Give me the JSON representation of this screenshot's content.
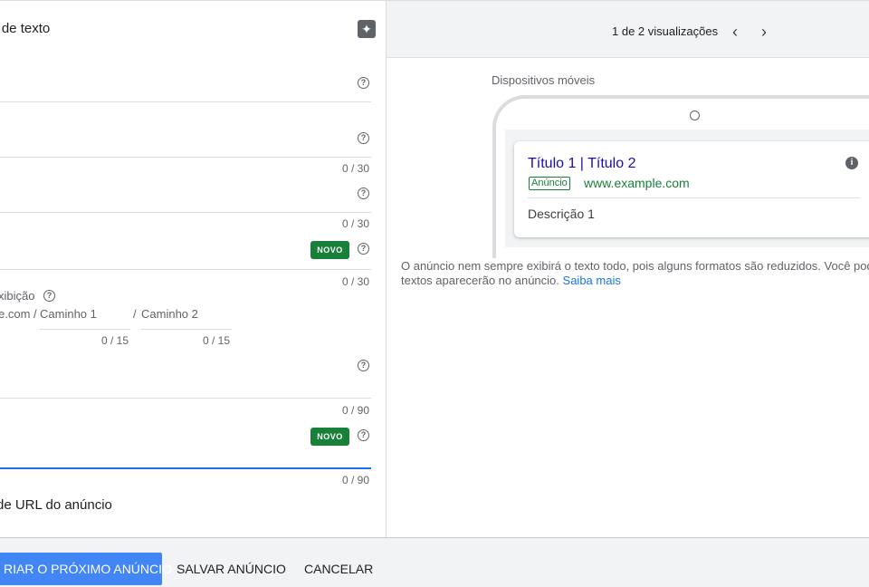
{
  "form": {
    "title": "io de texto",
    "fields": [
      {
        "counter": ""
      },
      {
        "counter": "0 / 30"
      },
      {
        "counter": "0 / 30"
      },
      {
        "counter": "0 / 30"
      },
      {
        "counter": "0 / 90"
      },
      {
        "counter": "0 / 90"
      }
    ],
    "new_badge": "NOVO",
    "display_path": {
      "label": "xibição",
      "domain": "e.com /",
      "path1_placeholder": "Caminho 1",
      "path2_prefix": "/",
      "path2_placeholder": "Caminho 2",
      "path1_counter": "0 / 15",
      "path2_counter": "0 / 15"
    },
    "url_options_label": "de URL do anúncio"
  },
  "preview": {
    "views_label": "1 de 2 visualizações",
    "prev_icon": "chevron-left-icon",
    "next_icon": "chevron-right-icon",
    "device_label": "Dispositivos móveis",
    "ad": {
      "headline": "Título 1 | Título 2",
      "badge": "Anúncio",
      "url": "www.example.com",
      "description": "Descrição 1"
    },
    "notice_line1": "O anúncio nem sempre exibirá o texto todo, pois alguns formatos são reduzidos. Você pod",
    "notice_line2": "textos aparecerão no anúncio.",
    "notice_link": "Saiba mais"
  },
  "footer": {
    "create_next": "RIAR O PRÓXIMO ANÚNCIO",
    "save": "SALVAR ANÚNCIO",
    "cancel": "CANCELAR"
  },
  "colors": {
    "primary_button": "#4285f4",
    "badge_green": "#188038",
    "link_blue": "#1a73e8",
    "ad_title_blue": "#1a0dab"
  }
}
